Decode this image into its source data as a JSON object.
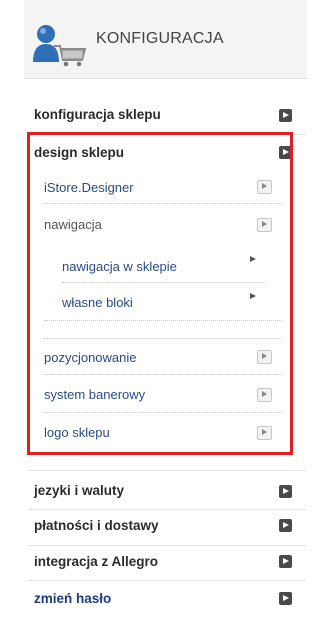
{
  "header": {
    "title": "KONFIGURACJA",
    "icon": "user-cart-icon"
  },
  "menu": {
    "store_config": "konfiguracja sklepu",
    "design": "design sklepu",
    "design_items": {
      "istore_designer": "iStore.Designer",
      "navigation": "nawigacja",
      "nav_in_store": "nawigacja w sklepie",
      "own_blocks": "własne bloki",
      "positioning": "pozycjonowanie",
      "banner_system": "system banerowy",
      "store_logo": "logo sklepu"
    },
    "languages": "jezyki i waluty",
    "payments": "płatności i dostawy",
    "allegro": "integracja z Allegro",
    "change_password": "zmień hasło"
  },
  "colors": {
    "highlight": "#e02020",
    "link": "#2a4a8a"
  }
}
